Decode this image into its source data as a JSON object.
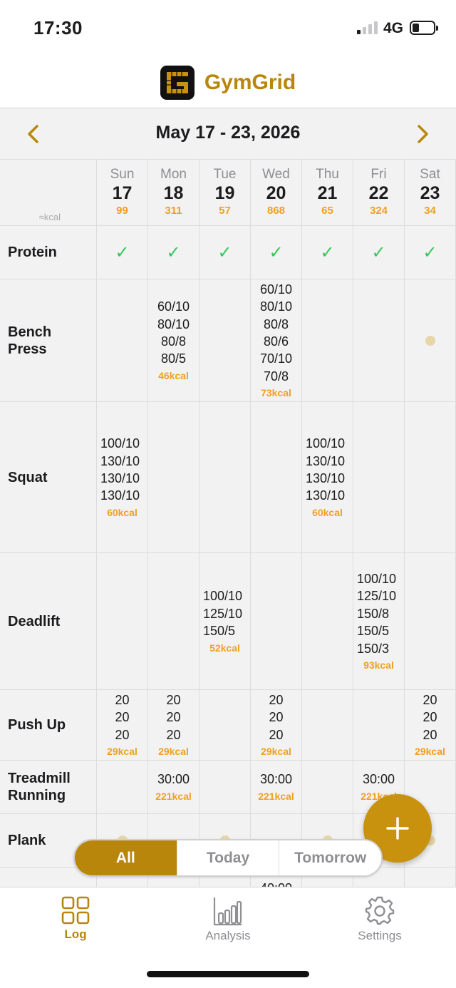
{
  "status": {
    "time": "17:30",
    "network": "4G"
  },
  "app": {
    "title": "GymGrid"
  },
  "week": {
    "range": "May 17 - 23, 2026"
  },
  "grid": {
    "kcal_hint": "≈kcal",
    "days": [
      {
        "name": "Sun",
        "num": "17",
        "kcal": "99"
      },
      {
        "name": "Mon",
        "num": "18",
        "kcal": "311"
      },
      {
        "name": "Tue",
        "num": "19",
        "kcal": "57"
      },
      {
        "name": "Wed",
        "num": "20",
        "kcal": "868"
      },
      {
        "name": "Thu",
        "num": "21",
        "kcal": "65"
      },
      {
        "name": "Fri",
        "num": "22",
        "kcal": "324"
      },
      {
        "name": "Sat",
        "num": "23",
        "kcal": "34"
      }
    ],
    "rows": [
      {
        "label": "Protein",
        "cells": [
          {
            "check": "✓"
          },
          {
            "check": "✓"
          },
          {
            "check": "✓"
          },
          {
            "check": "✓"
          },
          {
            "check": "✓"
          },
          {
            "check": "✓"
          },
          {
            "check": "✓"
          }
        ]
      },
      {
        "label": "Bench\nPress",
        "cells": [
          {},
          {
            "sets": [
              "60/10",
              "80/10",
              "80/8",
              "80/5"
            ],
            "kcal": "46kcal"
          },
          {},
          {
            "sets": [
              "60/10",
              "80/10",
              "80/8",
              "80/6",
              "70/10",
              "70/8"
            ],
            "kcal": "73kcal"
          },
          {},
          {},
          {
            "dot": true
          }
        ]
      },
      {
        "label": "Squat",
        "cells": [
          {
            "sets": [
              "100/10",
              "130/10",
              "130/10",
              "130/10"
            ],
            "kcal": "60kcal"
          },
          {},
          {},
          {},
          {
            "sets": [
              "100/10",
              "130/10",
              "130/10",
              "130/10"
            ],
            "kcal": "60kcal"
          },
          {},
          {}
        ]
      },
      {
        "label": "Deadlift",
        "cells": [
          {},
          {},
          {
            "sets": [
              "100/10",
              "125/10",
              "150/5"
            ],
            "kcal": "52kcal"
          },
          {},
          {},
          {
            "sets": [
              "100/10",
              "125/10",
              "150/8",
              "150/5",
              "150/3"
            ],
            "kcal": "93kcal"
          },
          {}
        ]
      },
      {
        "label": "Push Up",
        "cells": [
          {
            "sets": [
              "20",
              "20",
              "20"
            ],
            "kcal": "29kcal"
          },
          {
            "sets": [
              "20",
              "20",
              "20"
            ],
            "kcal": "29kcal"
          },
          {},
          {
            "sets": [
              "20",
              "20",
              "20"
            ],
            "kcal": "29kcal"
          },
          {},
          {},
          {
            "sets": [
              "20",
              "20",
              "20"
            ],
            "kcal": "29kcal"
          }
        ]
      },
      {
        "label": "Treadmill\nRunning",
        "cells": [
          {},
          {
            "sets": [
              "30:00"
            ],
            "kcal": "221kcal"
          },
          {},
          {
            "sets": [
              "30:00"
            ],
            "kcal": "221kcal"
          },
          {},
          {
            "sets": [
              "30:00"
            ],
            "kcal": "221kcal"
          },
          {}
        ]
      },
      {
        "label": "Plank",
        "cells": [
          {
            "dot": true
          },
          {},
          {
            "dot": true
          },
          {},
          {
            "dot": true
          },
          {},
          {
            "dot": true
          }
        ]
      },
      {
        "label": "",
        "cells": [
          {},
          {},
          {},
          {
            "sets": [
              "40:00"
            ]
          },
          {},
          {},
          {}
        ]
      }
    ]
  },
  "filter": {
    "options": [
      "All",
      "Today",
      "Tomorrow"
    ],
    "active": 0
  },
  "tabs": [
    {
      "label": "Log",
      "icon": "grid-icon"
    },
    {
      "label": "Analysis",
      "icon": "bar-chart-icon"
    },
    {
      "label": "Settings",
      "icon": "gear-icon"
    }
  ],
  "tabs_active": 0,
  "colors": {
    "accent": "#b8860b",
    "kcal": "#f0a020",
    "check": "#34c759"
  }
}
